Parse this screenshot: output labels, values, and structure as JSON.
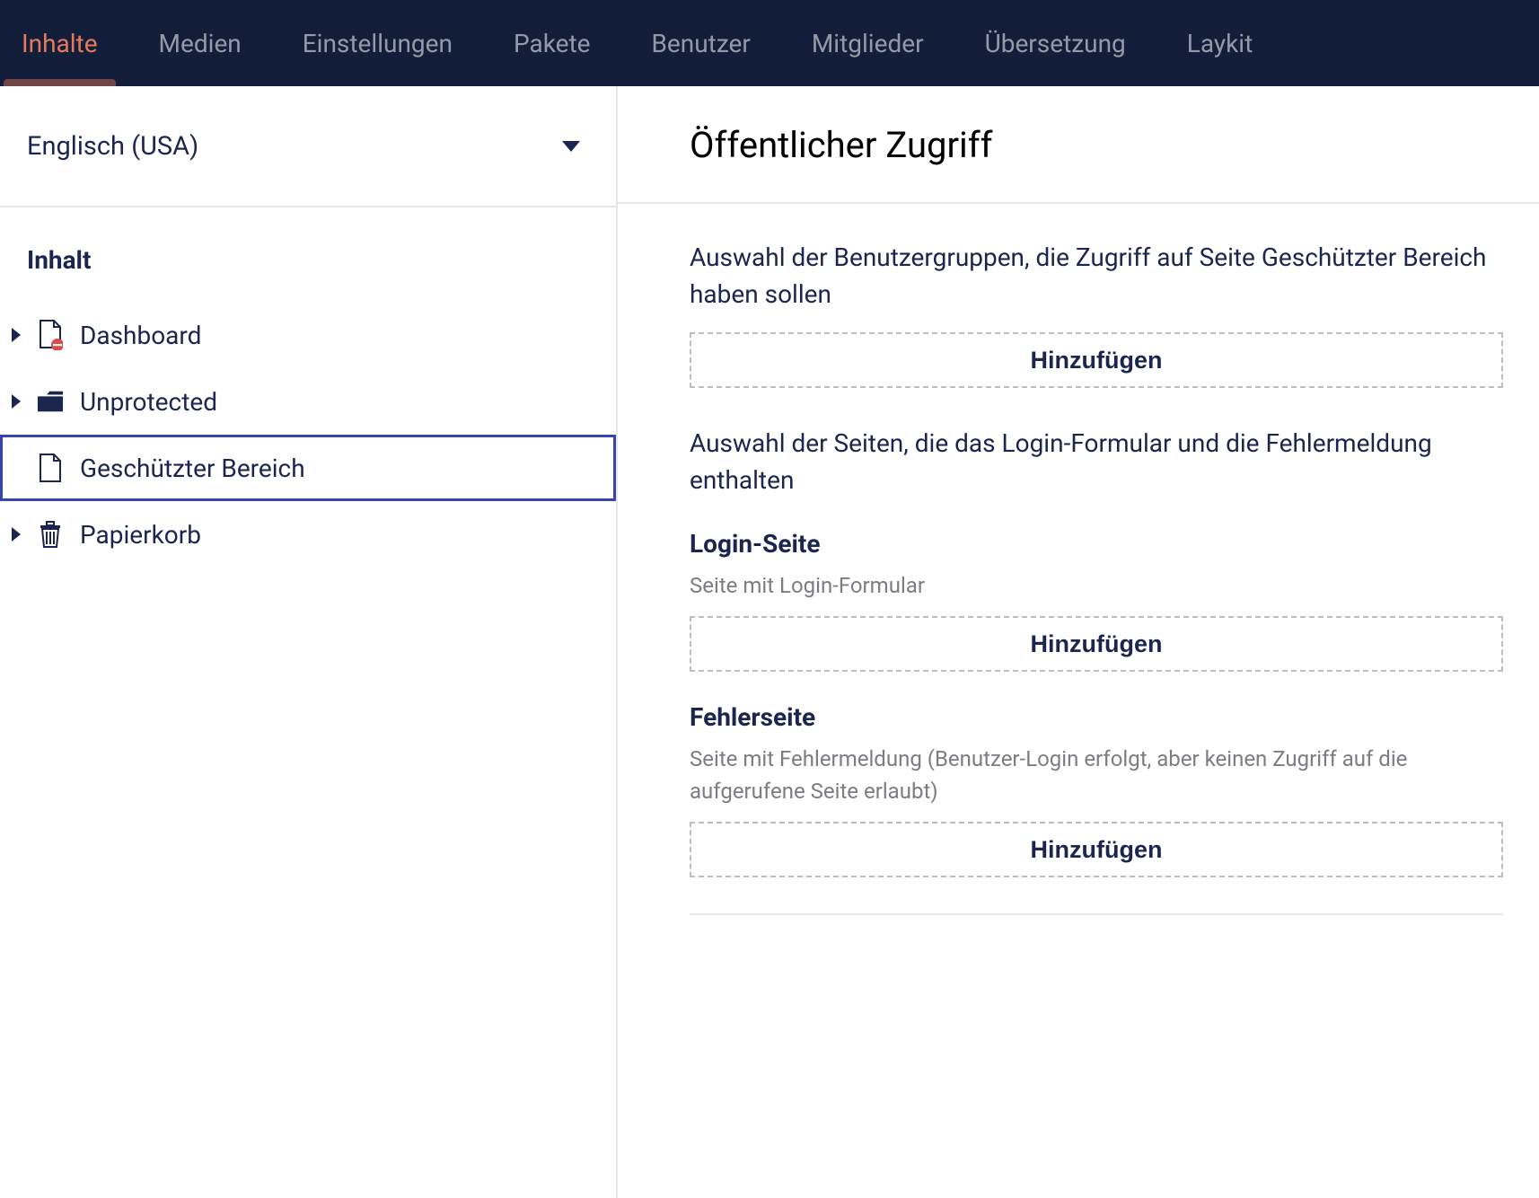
{
  "topnav": {
    "items": [
      {
        "label": "Inhalte",
        "active": true
      },
      {
        "label": "Medien"
      },
      {
        "label": "Einstellungen"
      },
      {
        "label": "Pakete"
      },
      {
        "label": "Benutzer"
      },
      {
        "label": "Mitglieder"
      },
      {
        "label": "Übersetzung"
      },
      {
        "label": "Laykit"
      }
    ]
  },
  "sidebar": {
    "language_label": "Englisch (USA)",
    "section_title": "Inhalt",
    "tree": [
      {
        "label": "Dashboard",
        "icon": "doc-blocked",
        "expandable": true,
        "selected": false
      },
      {
        "label": "Unprotected",
        "icon": "folder",
        "expandable": true,
        "selected": false
      },
      {
        "label": "Geschützter Bereich",
        "icon": "doc",
        "expandable": false,
        "selected": true
      },
      {
        "label": "Papierkorb",
        "icon": "trash",
        "expandable": true,
        "selected": false
      }
    ]
  },
  "main": {
    "title": "Öffentlicher Zugriff",
    "group_section_label": "Auswahl der Benutzergruppen, die Zugriff auf Seite Geschützter Bereich haben sollen",
    "group_add_label": "Hinzufügen",
    "pages_section_label": "Auswahl der Seiten, die das Login-Formular und die Fehlermeldung enthalten",
    "login": {
      "label": "Login-Seite",
      "help": "Seite mit Login-Formular",
      "add_label": "Hinzufügen"
    },
    "error": {
      "label": "Fehlerseite",
      "help": "Seite mit Fehlermeldung (Benutzer-Login erfolgt, aber keinen Zugriff auf die aufgerufene Seite erlaubt)",
      "add_label": "Hinzufügen"
    }
  }
}
